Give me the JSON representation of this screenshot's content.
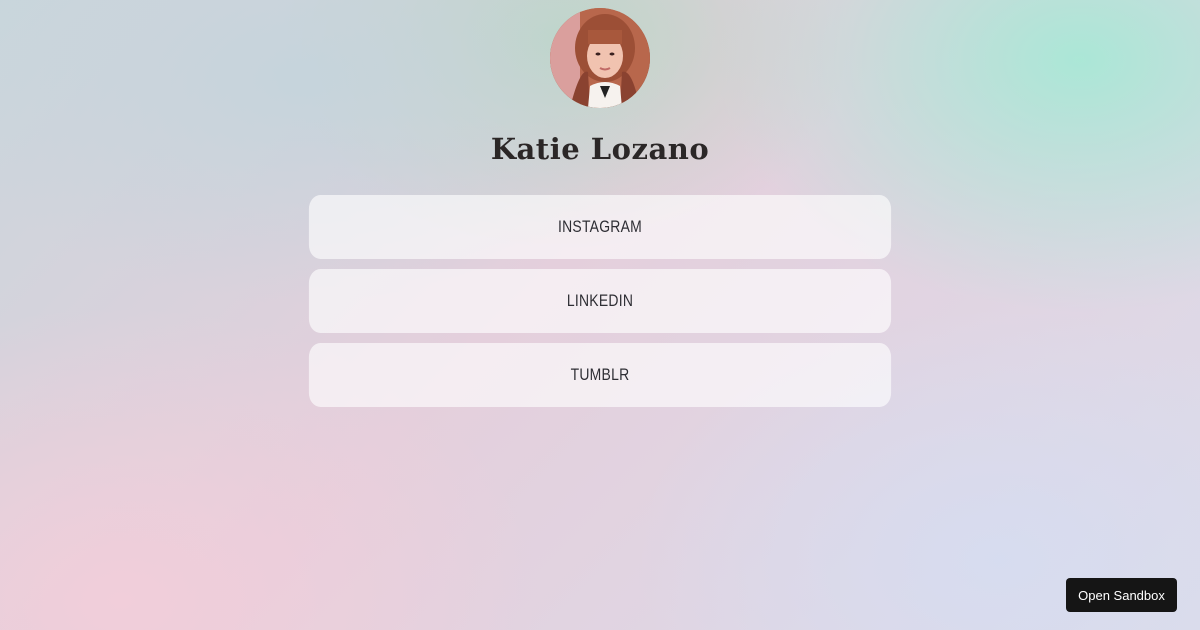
{
  "profile": {
    "name": "Katie Lozano",
    "avatar": "profile-photo"
  },
  "links": [
    {
      "label": "INSTAGRAM"
    },
    {
      "label": "LINKEDIN"
    },
    {
      "label": "TUMBLR"
    }
  ],
  "sandbox_button": {
    "label": "Open Sandbox"
  },
  "colors": {
    "name_text": "#2b2727",
    "link_text": "#2e2e34",
    "sandbox_bg": "#151515",
    "sandbox_text": "#ffffff"
  }
}
